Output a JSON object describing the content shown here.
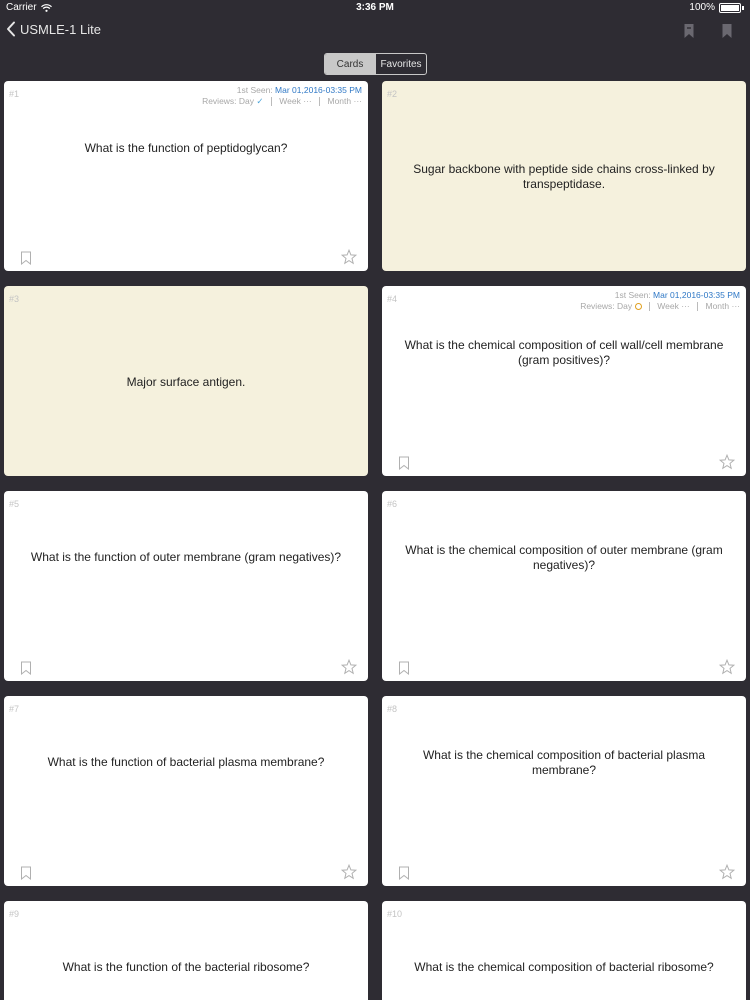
{
  "status_bar": {
    "carrier": "Carrier",
    "time": "3:36 PM",
    "battery": "100%"
  },
  "nav": {
    "back_label": "USMLE-1 Lite"
  },
  "segments": {
    "cards": "Cards",
    "favorites": "Favorites",
    "selected": "Cards"
  },
  "meta_labels": {
    "first_seen": "1st Seen:",
    "reviews": "Reviews:",
    "day": "Day",
    "week": "Week",
    "month": "Month",
    "dots": "···"
  },
  "cards": [
    {
      "number": "#1",
      "text": "What is the function of peptidoglycan?",
      "side": "question",
      "first_seen": "Mar 01,2016-03:35 PM",
      "day_status": "checked"
    },
    {
      "number": "#2",
      "text": "Sugar backbone with peptide side chains cross-linked by transpeptidase.",
      "side": "answer"
    },
    {
      "number": "#3",
      "text": "Major surface antigen.",
      "side": "answer"
    },
    {
      "number": "#4",
      "text": "What is the chemical composition of cell wall/cell membrane (gram positives)?",
      "side": "question",
      "first_seen": "Mar 01,2016-03:35 PM",
      "day_status": "pending"
    },
    {
      "number": "#5",
      "text": "What is the function of outer membrane (gram negatives)?",
      "side": "question"
    },
    {
      "number": "#6",
      "text": "What is the chemical composition of outer membrane (gram negatives)?",
      "side": "question"
    },
    {
      "number": "#7",
      "text": "What is the function of bacterial plasma membrane?",
      "side": "question"
    },
    {
      "number": "#8",
      "text": "What is the chemical composition of bacterial plasma membrane?",
      "side": "question"
    },
    {
      "number": "#9",
      "text": "What is the function of the bacterial ribosome?",
      "side": "question"
    },
    {
      "number": "#10",
      "text": "What is the chemical composition of bacterial ribosome?",
      "side": "question"
    }
  ]
}
